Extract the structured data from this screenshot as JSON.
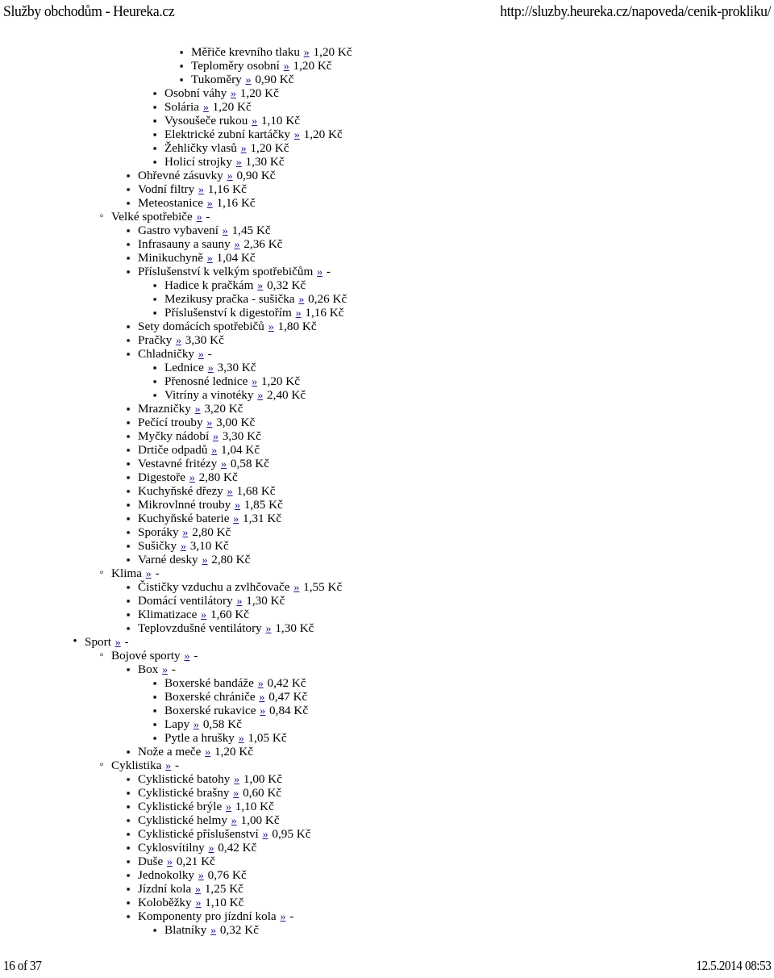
{
  "header": {
    "doc_title": "Služby obchodům - Heureka.cz",
    "url": "http://sluzby.heureka.cz/napoveda/cenik-prokliku/"
  },
  "footer": {
    "page_indicator": "16 of 37",
    "timestamp": "12.5.2014 08:53"
  },
  "link_marker": "»",
  "colors": {
    "link": "#1b1b8f",
    "text": "#000000",
    "background": "#ffffff"
  },
  "outline": {
    "items": [
      {
        "level": 5,
        "bullet": "square",
        "label": "Měřiče krevního tlaku",
        "value": "1,20 Kč"
      },
      {
        "level": 5,
        "bullet": "square",
        "label": "Teploměry osobní",
        "value": "1,20 Kč"
      },
      {
        "level": 5,
        "bullet": "square",
        "label": "Tukoměry",
        "value": "0,90 Kč"
      },
      {
        "level": 4,
        "bullet": "square",
        "label": "Osobní váhy",
        "value": "1,20 Kč"
      },
      {
        "level": 4,
        "bullet": "square",
        "label": "Solária",
        "value": "1,20 Kč"
      },
      {
        "level": 4,
        "bullet": "square",
        "label": "Vysoušeče rukou",
        "value": "1,10 Kč"
      },
      {
        "level": 4,
        "bullet": "square",
        "label": "Elektrické zubní kartáčky",
        "value": "1,20 Kč"
      },
      {
        "level": 4,
        "bullet": "square",
        "label": "Žehličky vlasů",
        "value": "1,20 Kč"
      },
      {
        "level": 4,
        "bullet": "square",
        "label": "Holicí strojky",
        "value": "1,30 Kč"
      },
      {
        "level": 3,
        "bullet": "square",
        "label": "Ohřevné zásuvky",
        "value": "0,90 Kč"
      },
      {
        "level": 3,
        "bullet": "square",
        "label": "Vodní filtry",
        "value": "1,16 Kč"
      },
      {
        "level": 3,
        "bullet": "square",
        "label": "Meteostanice",
        "value": "1,16 Kč"
      },
      {
        "level": 2,
        "bullet": "circle",
        "label": "Velké spotřebiče",
        "value": "-"
      },
      {
        "level": 3,
        "bullet": "square",
        "label": "Gastro vybavení",
        "value": "1,45 Kč"
      },
      {
        "level": 3,
        "bullet": "square",
        "label": "Infrasauny a sauny",
        "value": "2,36 Kč"
      },
      {
        "level": 3,
        "bullet": "square",
        "label": "Minikuchyně",
        "value": "1,04 Kč"
      },
      {
        "level": 3,
        "bullet": "square",
        "label": "Příslušenství k velkým spotřebičům",
        "value": "-"
      },
      {
        "level": 4,
        "bullet": "square",
        "label": "Hadice k pračkám",
        "value": "0,32 Kč"
      },
      {
        "level": 4,
        "bullet": "square",
        "label": "Mezikusy pračka - sušička",
        "value": "0,26 Kč"
      },
      {
        "level": 4,
        "bullet": "square",
        "label": "Příslušenství k digestořím",
        "value": "1,16 Kč"
      },
      {
        "level": 3,
        "bullet": "square",
        "label": "Sety domácích spotřebičů",
        "value": "1,80 Kč"
      },
      {
        "level": 3,
        "bullet": "square",
        "label": "Pračky",
        "value": "3,30 Kč"
      },
      {
        "level": 3,
        "bullet": "square",
        "label": "Chladničky",
        "value": "-"
      },
      {
        "level": 4,
        "bullet": "square",
        "label": "Lednice",
        "value": "3,30 Kč"
      },
      {
        "level": 4,
        "bullet": "square",
        "label": "Přenosné lednice",
        "value": "1,20 Kč"
      },
      {
        "level": 4,
        "bullet": "square",
        "label": "Vitríny a vinotéky",
        "value": "2,40 Kč"
      },
      {
        "level": 3,
        "bullet": "square",
        "label": "Mrazničky",
        "value": "3,20 Kč"
      },
      {
        "level": 3,
        "bullet": "square",
        "label": "Pečící trouby",
        "value": "3,00 Kč"
      },
      {
        "level": 3,
        "bullet": "square",
        "label": "Myčky nádobí",
        "value": "3,30 Kč"
      },
      {
        "level": 3,
        "bullet": "square",
        "label": "Drtiče odpadů",
        "value": "1,04 Kč"
      },
      {
        "level": 3,
        "bullet": "square",
        "label": "Vestavné fritézy",
        "value": "0,58 Kč"
      },
      {
        "level": 3,
        "bullet": "square",
        "label": "Digestoře",
        "value": "2,80 Kč"
      },
      {
        "level": 3,
        "bullet": "square",
        "label": "Kuchyňské dřezy",
        "value": "1,68 Kč"
      },
      {
        "level": 3,
        "bullet": "square",
        "label": "Mikrovlnné trouby",
        "value": "1,85 Kč"
      },
      {
        "level": 3,
        "bullet": "square",
        "label": "Kuchyňské baterie",
        "value": "1,31 Kč"
      },
      {
        "level": 3,
        "bullet": "square",
        "label": "Sporáky",
        "value": "2,80 Kč"
      },
      {
        "level": 3,
        "bullet": "square",
        "label": "Sušičky",
        "value": "3,10 Kč"
      },
      {
        "level": 3,
        "bullet": "square",
        "label": "Varné desky",
        "value": "2,80 Kč"
      },
      {
        "level": 2,
        "bullet": "circle",
        "label": "Klima",
        "value": "-"
      },
      {
        "level": 3,
        "bullet": "square",
        "label": "Čističky vzduchu a zvlhčovače",
        "value": "1,55 Kč"
      },
      {
        "level": 3,
        "bullet": "square",
        "label": "Domácí ventilátory",
        "value": "1,30 Kč"
      },
      {
        "level": 3,
        "bullet": "square",
        "label": "Klimatizace",
        "value": "1,60 Kč"
      },
      {
        "level": 3,
        "bullet": "square",
        "label": "Teplovzdušné ventilátory",
        "value": "1,30 Kč"
      },
      {
        "level": 1,
        "bullet": "disc",
        "label": "Sport",
        "value": "-"
      },
      {
        "level": 2,
        "bullet": "circle",
        "label": "Bojové sporty",
        "value": "-"
      },
      {
        "level": 3,
        "bullet": "square",
        "label": "Box",
        "value": "-"
      },
      {
        "level": 4,
        "bullet": "square",
        "label": "Boxerské bandáže",
        "value": "0,42 Kč"
      },
      {
        "level": 4,
        "bullet": "square",
        "label": "Boxerské chrániče",
        "value": "0,47 Kč"
      },
      {
        "level": 4,
        "bullet": "square",
        "label": "Boxerské rukavice",
        "value": "0,84 Kč"
      },
      {
        "level": 4,
        "bullet": "square",
        "label": "Lapy",
        "value": "0,58 Kč"
      },
      {
        "level": 4,
        "bullet": "square",
        "label": "Pytle a hrušky",
        "value": "1,05 Kč"
      },
      {
        "level": 3,
        "bullet": "square",
        "label": "Nože a meče",
        "value": "1,20 Kč"
      },
      {
        "level": 2,
        "bullet": "circle",
        "label": "Cyklistika",
        "value": "-"
      },
      {
        "level": 3,
        "bullet": "square",
        "label": "Cyklistické batohy",
        "value": "1,00 Kč"
      },
      {
        "level": 3,
        "bullet": "square",
        "label": "Cyklistické brašny",
        "value": "0,60 Kč"
      },
      {
        "level": 3,
        "bullet": "square",
        "label": "Cyklistické brýle",
        "value": "1,10 Kč"
      },
      {
        "level": 3,
        "bullet": "square",
        "label": "Cyklistické helmy",
        "value": "1,00 Kč"
      },
      {
        "level": 3,
        "bullet": "square",
        "label": "Cyklistické příslušenství",
        "value": "0,95 Kč"
      },
      {
        "level": 3,
        "bullet": "square",
        "label": "Cyklosvítilny",
        "value": "0,42 Kč"
      },
      {
        "level": 3,
        "bullet": "square",
        "label": "Duše",
        "value": "0,21 Kč"
      },
      {
        "level": 3,
        "bullet": "square",
        "label": "Jednokolky",
        "value": "0,76 Kč"
      },
      {
        "level": 3,
        "bullet": "square",
        "label": "Jízdní kola",
        "value": "1,25 Kč"
      },
      {
        "level": 3,
        "bullet": "square",
        "label": "Koloběžky",
        "value": "1,10 Kč"
      },
      {
        "level": 3,
        "bullet": "square",
        "label": "Komponenty pro jízdní kola",
        "value": "-"
      },
      {
        "level": 4,
        "bullet": "square",
        "label": "Blatníky",
        "value": "0,32 Kč"
      }
    ]
  }
}
